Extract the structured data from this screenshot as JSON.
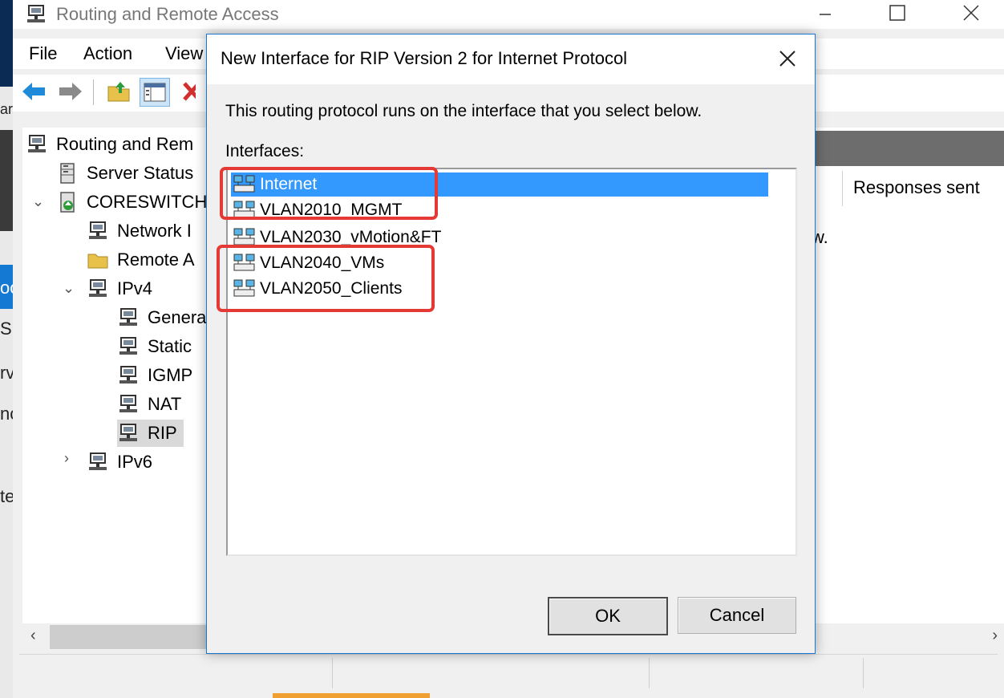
{
  "window": {
    "title": "Routing and Remote Access",
    "controls": [
      "minimize",
      "maximize",
      "close"
    ]
  },
  "menu": [
    "File",
    "Action",
    "View"
  ],
  "toolbar": [
    "back-arrow-icon",
    "forward-arrow-icon",
    "up-folder-icon",
    "show-hide-pane-icon",
    "delete-icon"
  ],
  "tree": {
    "items": [
      {
        "label": "Routing and Rem",
        "icon": "server-icon"
      },
      {
        "label": "Server Status",
        "icon": "server-stack-icon"
      },
      {
        "label": "CORESWITCH",
        "icon": "server-up-icon"
      },
      {
        "label": "Network I",
        "icon": "network-icon"
      },
      {
        "label": "Remote A",
        "icon": "folder-icon"
      },
      {
        "label": "IPv4",
        "icon": "network-icon"
      },
      {
        "label": "Genera",
        "icon": "network-icon"
      },
      {
        "label": "Static",
        "icon": "network-icon"
      },
      {
        "label": "IGMP",
        "icon": "network-icon"
      },
      {
        "label": "NAT",
        "icon": "network-icon"
      },
      {
        "label": "RIP",
        "icon": "network-icon"
      },
      {
        "label": "IPv6",
        "icon": "network-icon"
      }
    ]
  },
  "right_pane": {
    "column_header": "Responses sent",
    "fragment": "w."
  },
  "desktop_fragments": [
    "ar",
    "oo",
    "S",
    "rv",
    "nc",
    "te"
  ],
  "dialog": {
    "title": "New Interface for RIP Version 2 for Internet Protocol",
    "description": "This routing protocol runs on the interface that you select below.",
    "interfaces_label": "Interfaces:",
    "interfaces": [
      {
        "name": "Internet",
        "selected": true
      },
      {
        "name": "VLAN2010_MGMT",
        "selected": false
      },
      {
        "name": "VLAN2030_vMotion&FT",
        "selected": false
      },
      {
        "name": "VLAN2040_VMs",
        "selected": false
      },
      {
        "name": "VLAN2050_Clients",
        "selected": false
      }
    ],
    "ok_label": "OK",
    "cancel_label": "Cancel"
  },
  "colors": {
    "selection": "#3399ff",
    "highlight_box": "#e53935",
    "dialog_border": "#1a77d2"
  }
}
